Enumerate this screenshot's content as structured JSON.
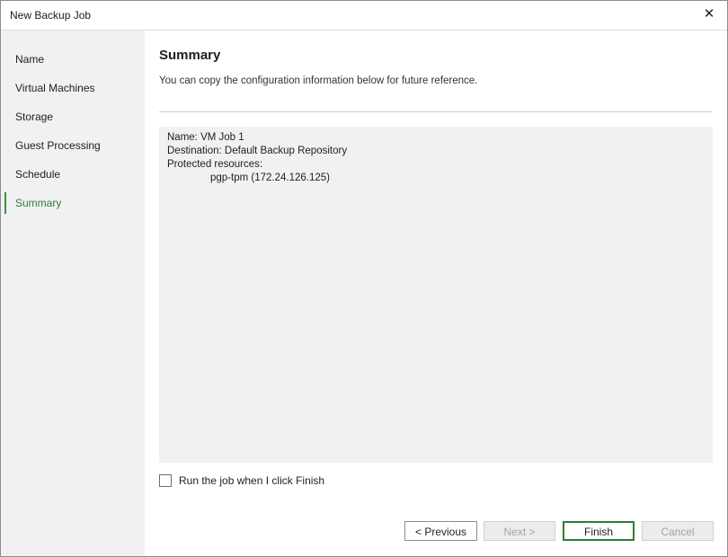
{
  "window": {
    "title": "New Backup Job"
  },
  "sidebar": {
    "items": [
      {
        "label": "Name"
      },
      {
        "label": "Virtual Machines"
      },
      {
        "label": "Storage"
      },
      {
        "label": "Guest Processing"
      },
      {
        "label": "Schedule"
      },
      {
        "label": "Summary",
        "active": true
      }
    ]
  },
  "main": {
    "heading": "Summary",
    "description": "You can copy the configuration information below for future reference.",
    "summary": {
      "name_line": "Name: VM Job 1",
      "destination_line": "Destination: Default Backup Repository",
      "protected_line": "Protected resources:",
      "resource_line": "pgp-tpm (172.24.126.125)"
    },
    "run_checkbox": {
      "label": "Run the job when I click Finish",
      "checked": false
    }
  },
  "buttons": {
    "previous": "< Previous",
    "next": "Next >",
    "finish": "Finish",
    "cancel": "Cancel"
  },
  "colors": {
    "accent": "#2f7d37",
    "sidebar_bg": "#f1f1f1",
    "summary_bg": "#f0f1f0"
  }
}
